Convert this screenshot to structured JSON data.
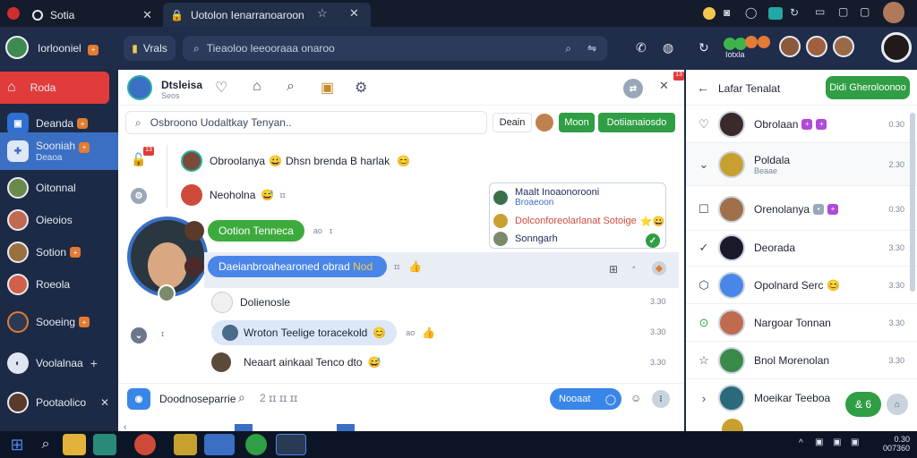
{
  "tabs": [
    {
      "label": "Sotia"
    },
    {
      "label": "Uotolon Ienarranoaroon"
    }
  ],
  "nav": {
    "app_label": "Vrals",
    "search_placeholder": "Tieaoloo leeooraaa onaroo",
    "account_label": "Iotxla"
  },
  "left_nav": [
    {
      "label": "Roda",
      "badge": ""
    },
    {
      "label": "Deanda",
      "badge": "+"
    },
    {
      "label": "Sooniah",
      "sub": "Deaoa",
      "badge": "+"
    },
    {
      "label": "Oitonnal",
      "badge": ""
    },
    {
      "label": "Oieoios",
      "badge": ""
    },
    {
      "label": "Sotion",
      "badge": "+"
    },
    {
      "label": "Roeola",
      "badge": ""
    },
    {
      "label": "Sooeing",
      "badge": "+"
    },
    {
      "label": "Voolalnaa",
      "badge": ""
    },
    {
      "label": "Pootaolico",
      "badge": ""
    }
  ],
  "chat": {
    "title": "Dtsleisa",
    "subtitle": "Seos",
    "search_placeholder": "Osbroono Uodaltkay Tenyan..",
    "filter_label": "Deain",
    "toggle_label": "Moon",
    "action_label": "Dotiianaiosdo",
    "notif_count": "13",
    "messages": [
      {
        "name": "Obroolanya",
        "text": "Dhsn brenda B harlak"
      },
      {
        "name": "Neoholna",
        "text": ""
      },
      {
        "name": "Ootion Tenneca",
        "text": "ao"
      },
      {
        "name": "Daeianbroahearoned obrad",
        "text": "Nod"
      },
      {
        "name": "Dolienosle",
        "text": ""
      },
      {
        "name": "Wroton Teelige toracekold",
        "text": "ao"
      },
      {
        "name": "Neaart ainkaal Tenco dto",
        "text": ""
      }
    ],
    "card": [
      {
        "title": "Maalt Inoaonorooni",
        "sub": "Broaeoon"
      },
      {
        "title": "Dolconforeolarlanat Sotoige",
        "sub": ""
      },
      {
        "title": "Sonngarh",
        "sub": ""
      }
    ],
    "compose_placeholder": "Doodnoseparrie",
    "send_label": "Nooaat"
  },
  "contacts": {
    "header": "Lafar Tenalat",
    "new_label": "Didi Gheroloonoo",
    "items": [
      {
        "name": "Obrolaan",
        "time": "0.30",
        "sub": ""
      },
      {
        "name": "Poldala",
        "time": "2.30",
        "sub": "Beaae"
      },
      {
        "name": "Orenolanya",
        "time": "0.30",
        "sub": ""
      },
      {
        "name": "Deorada",
        "time": "3.30",
        "sub": ""
      },
      {
        "name": "Opolnard Serc",
        "time": "3.30",
        "sub": ""
      },
      {
        "name": "Nargoar Tonnan",
        "time": "3.30",
        "sub": ""
      },
      {
        "name": "Bnol Morenolan",
        "time": "3.30",
        "sub": ""
      },
      {
        "name": "Moeikar Teeboa",
        "time": "",
        "sub": ""
      }
    ],
    "fab_label": "& 6"
  },
  "taskbar": {
    "clock": "0.30",
    "date": "007360"
  }
}
